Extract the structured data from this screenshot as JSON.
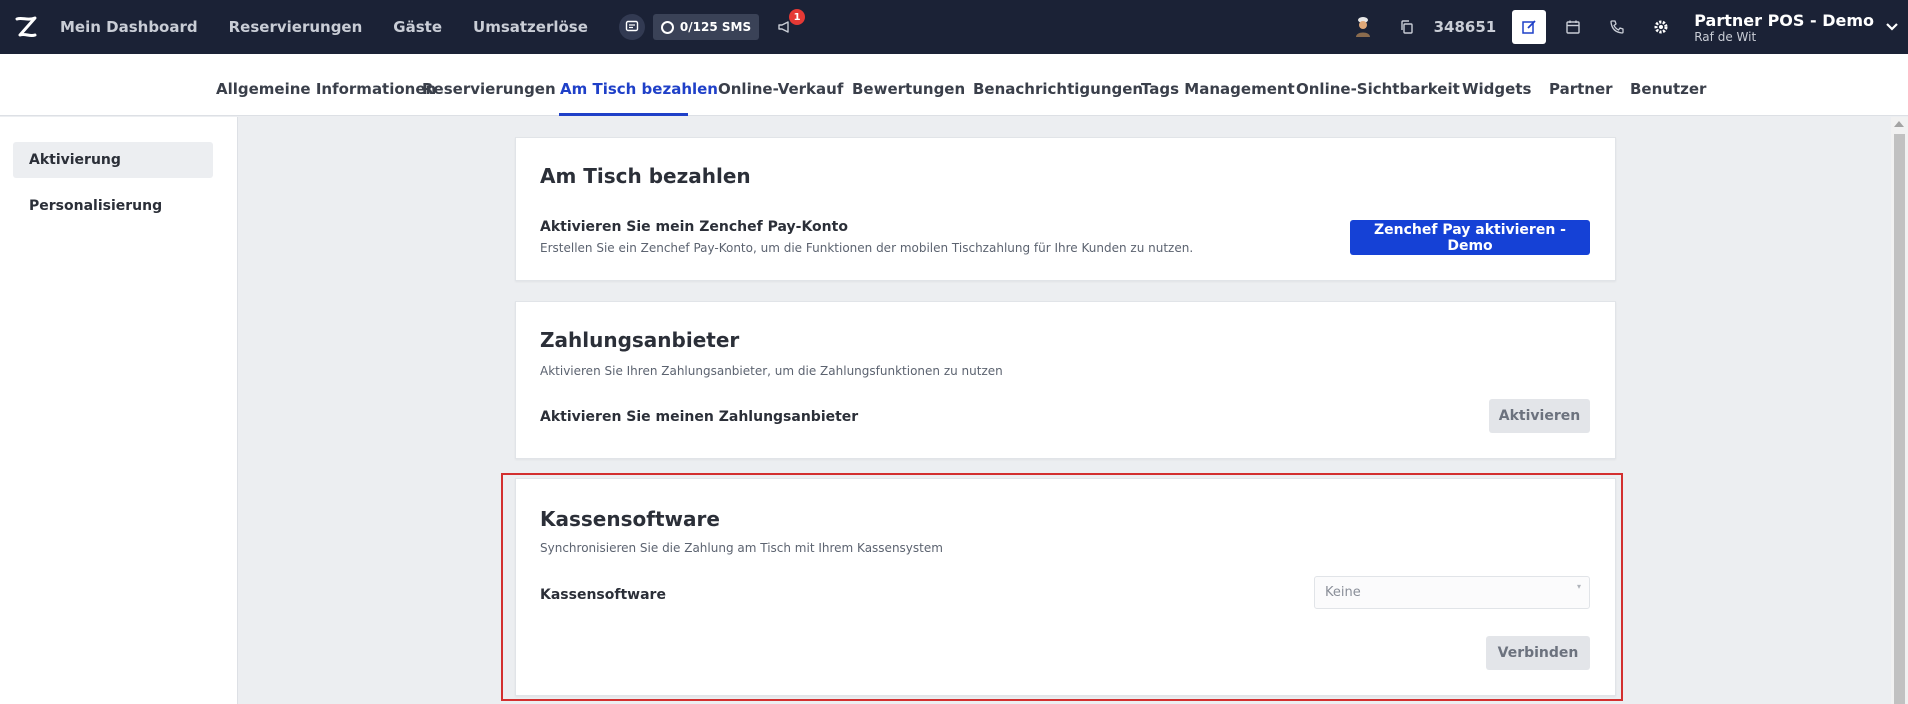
{
  "topbar": {
    "nav": [
      "Mein Dashboard",
      "Reservierungen",
      "Gäste",
      "Umsatzerlöse"
    ],
    "sms": "0/125 SMS",
    "notifications": "1",
    "account_id": "348651",
    "account_name": "Partner POS - Demo",
    "account_user": "Raf de Wit"
  },
  "tabs": {
    "items": [
      "Allgemeine Informationen",
      "Reservierungen",
      "Am Tisch bezahlen",
      "Online-Verkauf",
      "Bewertungen",
      "Benachrichtigungen",
      "Tags Management",
      "Online-Sichtbarkeit",
      "Widgets",
      "Partner",
      "Benutzer"
    ],
    "active": "Am Tisch bezahlen"
  },
  "sidebar": {
    "items": [
      "Aktivierung",
      "Personalisierung"
    ]
  },
  "card_pay": {
    "title": "Am Tisch bezahlen",
    "label": "Aktivieren Sie mein Zenchef Pay-Konto",
    "sub": "Erstellen Sie ein Zenchef Pay-Konto, um die Funktionen der mobilen Tischzahlung für Ihre Kunden zu nutzen.",
    "button": "Zenchef Pay aktivieren - Demo"
  },
  "card_provider": {
    "title": "Zahlungsanbieter",
    "sub": "Aktivieren Sie Ihren Zahlungsanbieter, um die Zahlungsfunktionen zu nutzen",
    "label": "Aktivieren Sie meinen Zahlungsanbieter",
    "button": "Aktivieren"
  },
  "card_pos": {
    "title": "Kassensoftware",
    "sub": "Synchronisieren Sie die Zahlung am Tisch mit Ihrem Kassensystem",
    "label": "Kassensoftware",
    "select_value": "Keine",
    "button": "Verbinden"
  },
  "colors": {
    "topbar": "#1b2236",
    "accent": "#1f40c8",
    "primary_button": "#1541d6",
    "highlight": "#d32f2f"
  }
}
